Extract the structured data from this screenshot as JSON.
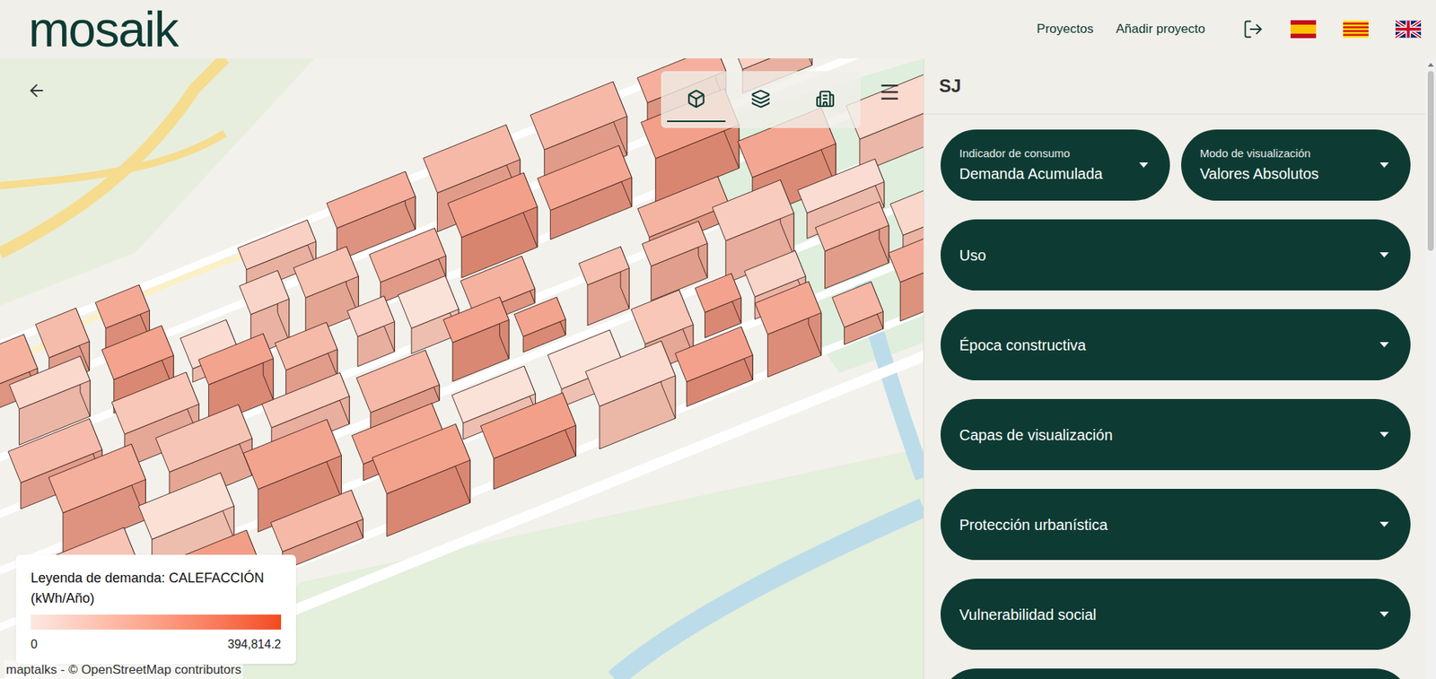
{
  "header": {
    "logo": "mosaik",
    "nav": [
      {
        "label": "Proyectos"
      },
      {
        "label": "Añadir proyecto"
      }
    ]
  },
  "map": {
    "toolbar": [
      {
        "kind": "cube",
        "selected": true
      },
      {
        "kind": "layers",
        "selected": false
      },
      {
        "kind": "building",
        "selected": false
      }
    ],
    "legend": {
      "title": "Leyenda de demanda: CALEFACCIÓN (kWh/Año)",
      "min": "0",
      "max": "394,814.2"
    },
    "attribution": "maptalks - © OpenStreetMap contributors"
  },
  "panel": {
    "title": "SJ",
    "selects": [
      {
        "label": "Indicador de consumo",
        "value": "Demanda Acumulada"
      },
      {
        "label": "Modo de visualización",
        "value": "Valores Absolutos"
      }
    ],
    "sections": [
      {
        "label": "Uso",
        "expanded": false
      },
      {
        "label": "Época constructiva",
        "expanded": false
      },
      {
        "label": "Capas de visualización",
        "expanded": false
      },
      {
        "label": "Protección urbanística",
        "expanded": false
      },
      {
        "label": "Vulnerabilidad social",
        "expanded": false
      }
    ]
  }
}
